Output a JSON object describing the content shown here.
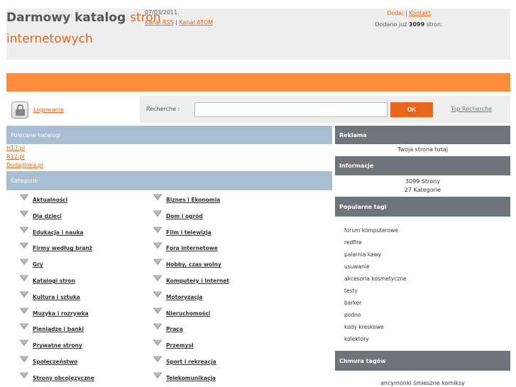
{
  "header": {
    "title_main": "Darmowy katalog ",
    "title_accent": "stron",
    "title_line2": "internetowych",
    "date": "07/03/2011.",
    "rss_label": "Kanał RSS",
    "atom_label": "Kanał ATOM",
    "separator": " | ",
    "add_label": "Dodaj",
    "contact_label": "Kontakt",
    "count_prefix": "Dodano już ",
    "count_value": "3099",
    "count_suffix": " stron."
  },
  "search": {
    "login_label": "Logowanie",
    "label": "Recherche :",
    "input_value": "",
    "button_label": "OK",
    "top_label": "Top Recherche"
  },
  "recommended": {
    "heading": "Polecane katalogi",
    "items": [
      "H13.pl",
      "R12.pl",
      "Dodajlinka.pl"
    ]
  },
  "categories": {
    "heading": "Kategorie",
    "left": [
      "Aktualności",
      "Dla dzieci",
      "Edukacja i nauka",
      "Firmy według branż",
      "Gry",
      "Katalogi stron",
      "Kultura i sztuka",
      "Muzyka i rozrywka",
      "Pieniądze i banki",
      "Prywatne strony",
      "Społeczeństwo",
      "Strony obcojęzyczne"
    ],
    "right": [
      "Biznes i Ekonomia",
      "Dom i ogród",
      "Film i telewizja",
      "Fora internetowe",
      "Hobby, czas wolny",
      "Komputery i Internet",
      "Motoryzacja",
      "Nieruchomości",
      "Praca",
      "Przemysł",
      "Sport i rekreacja",
      "Telekomunikacja"
    ]
  },
  "sidebar": {
    "ad_heading": "Reklama",
    "ad_text": "Twoja strona tutaj",
    "info_heading": "Informacje",
    "info_pages": "3099 Strony",
    "info_categories": "27 Kategorie",
    "tags_heading": "Popularne tagi",
    "tags": [
      "forum komputerowe",
      "redfire",
      "palarnia kawy",
      "usuwanie",
      "akcesoria kosmetyczne",
      "testy",
      "barker",
      "podno",
      "kody kreskowe",
      "kolektory"
    ],
    "cloud_heading": "Chmura tagów",
    "cloud_text": "ancymonki    śmieszne komiksy"
  },
  "colors": {
    "accent": "#e8651a",
    "orange_bar": "#ff8c3b",
    "blue_header": "#a7bfd1",
    "dark_header": "#6e7479"
  }
}
